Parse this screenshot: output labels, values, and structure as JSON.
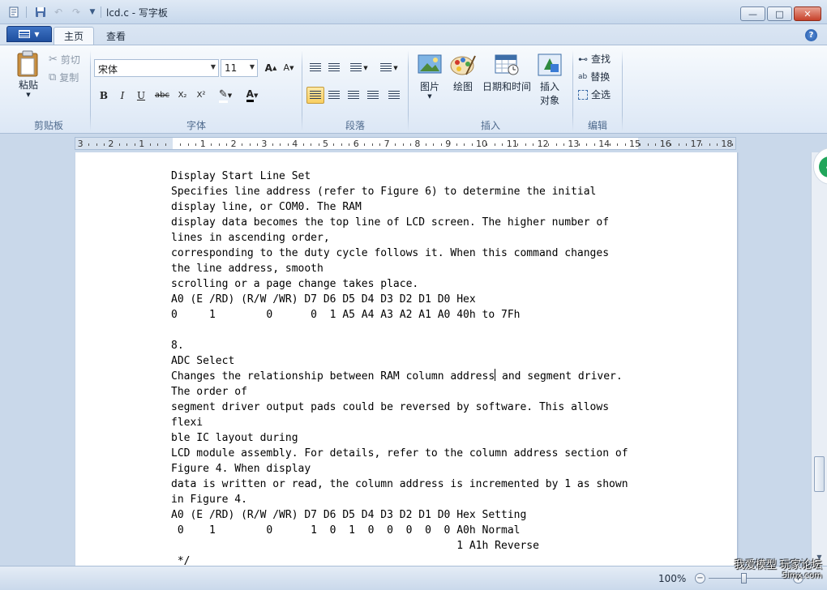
{
  "window": {
    "title": "lcd.c - 写字板",
    "minimize": "—",
    "maximize": "□",
    "close": "✕"
  },
  "tabs": {
    "home": "主页",
    "view": "查看"
  },
  "clipboard": {
    "paste": "粘贴",
    "cut": "剪切",
    "copy": "复制",
    "group": "剪贴板"
  },
  "font": {
    "family": "宋体",
    "size": "11",
    "group": "字体",
    "bold": "B",
    "italic": "I",
    "underline": "U",
    "strike": "abc",
    "sub": "X₂",
    "sup": "X²",
    "grow": "A",
    "shrink": "A"
  },
  "paragraph": {
    "group": "段落"
  },
  "insert": {
    "picture": "图片",
    "paint": "绘图",
    "datetime": "日期和时间",
    "object_line1": "插入",
    "object_line2": "对象",
    "group": "插入"
  },
  "editing": {
    "find": "查找",
    "replace": "替换",
    "select_all": "全选",
    "group": "编辑"
  },
  "ruler": {
    "numbers": [
      "3",
      "2",
      "1",
      "1",
      "2",
      "3",
      "4",
      "5",
      "6",
      "7",
      "8",
      "9",
      "10",
      "11",
      "12",
      "13",
      "14",
      "15",
      "16",
      "17",
      "18"
    ]
  },
  "document": {
    "lines": [
      "Display Start Line Set",
      "Specifies line address (refer to Figure 6) to determine the initial",
      "display line, or COM0. The RAM",
      "display data becomes the top line of LCD screen. The higher number of",
      "lines in ascending order,",
      "corresponding to the duty cycle follows it. When this command changes",
      "the line address, smooth",
      "scrolling or a page change takes place.",
      "A0 (E /RD) (R/W /WR) D7 D6 D5 D4 D3 D2 D1 D0 Hex",
      "0     1        0      0  1 A5 A4 A3 A2 A1 A0 40h to 7Fh",
      "",
      "8.",
      "ADC Select",
      "Changes the relationship between RAM column address| and segment driver.",
      "The order of",
      "segment driver output pads could be reversed by software. This allows",
      "flexi",
      "ble IC layout during",
      "LCD module assembly. For details, refer to the column address section of",
      "Figure 4. When display",
      "data is written or read, the column address is incremented by 1 as shown",
      "in Figure 4.",
      "A0 (E /RD) (R/W /WR) D7 D6 D5 D4 D3 D2 D1 D0 Hex Setting",
      " 0    1        0      1  0  1  0  0  0  0  0 A0h Normal",
      "                                             1 A1h Reverse",
      " */"
    ]
  },
  "status": {
    "zoom": "100%",
    "zoom_minus": "−",
    "zoom_plus": "+"
  },
  "watermark": {
    "line1": "我爱模型 玩家论坛",
    "line2": "5imx.com"
  }
}
